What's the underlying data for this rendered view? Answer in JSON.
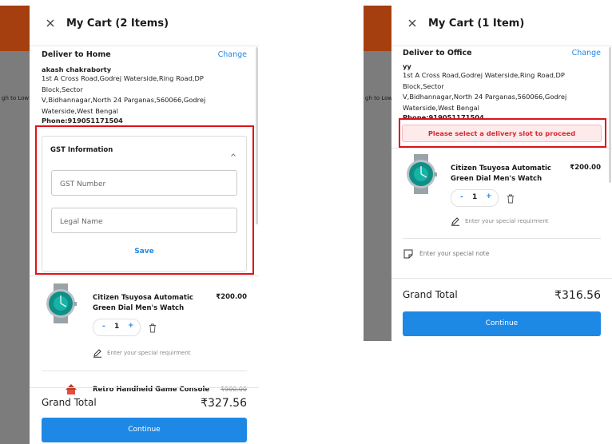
{
  "left": {
    "side_text": "gh to Low",
    "title": "My Cart (2 Items)",
    "deliver_label": "Deliver to Home",
    "change_label": "Change",
    "name": "akash chakraborty",
    "address_lines": [
      "1st A Cross Road,Godrej Waterside,Ring Road,DP Block,Sector",
      "V,Bidhannagar,North 24 Parganas,560066,Godrej",
      "Waterside,West Bengal"
    ],
    "phone": "Phone:919051171504",
    "gst": {
      "title": "GST Information",
      "gst_placeholder": "GST Number",
      "legal_placeholder": "Legal Name",
      "save_label": "Save"
    },
    "product": {
      "name": "Citizen Tsuyosa Automatic Green Dial Men's Watch",
      "price": "₹200.00",
      "minus": "-",
      "qty": "1",
      "plus": "+",
      "requirement_placeholder": "Enter your special requirment"
    },
    "product2": {
      "name": "Retro Handheld Game Console",
      "price": "₹900.00"
    },
    "grand_total_label": "Grand Total",
    "grand_total_value": "₹327.56",
    "continue_label": "Continue"
  },
  "right": {
    "side_text": "gh to Low",
    "title": "My Cart (1 Item)",
    "deliver_label": "Deliver to Office",
    "change_label": "Change",
    "name": "yy",
    "address_lines": [
      "1st A Cross Road,Godrej Waterside,Ring Road,DP Block,Sector",
      "V,Bidhannagar,North 24 Parganas,560066,Godrej",
      "Waterside,West Bengal"
    ],
    "phone": "Phone:919051171504",
    "warning": "Please select a delivery slot to proceed",
    "product": {
      "name": "Citizen Tsuyosa Automatic Green Dial Men's Watch",
      "price": "₹200.00",
      "minus": "-",
      "qty": "1",
      "plus": "+",
      "requirement_placeholder": "Enter your special requirment"
    },
    "note_placeholder": "Enter your special note",
    "grand_total_label": "Grand Total",
    "grand_total_value": "₹316.56",
    "continue_label": "Continue"
  },
  "colors": {
    "accent": "#1e88e5",
    "highlight": "#e0121a",
    "header_bg": "#a53f10"
  }
}
